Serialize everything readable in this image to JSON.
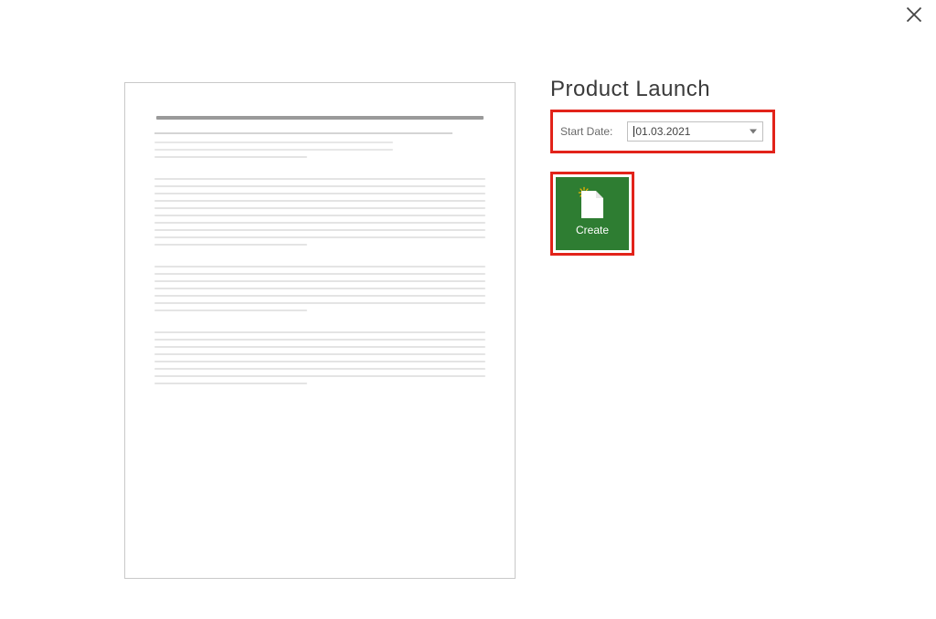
{
  "dialog": {
    "template_title": "Product Launch",
    "start_date_label": "Start Date:",
    "start_date_value": "01.03.2021",
    "create_label": "Create"
  }
}
